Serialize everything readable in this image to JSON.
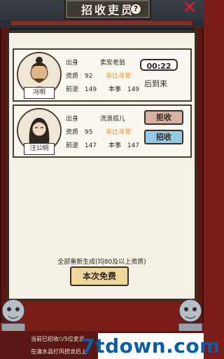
{
  "header": {
    "title": "招收吏员"
  },
  "candidates": [
    {
      "name": "冯明",
      "origin_label": "出身",
      "origin": "卖炭老翁",
      "aptitude_label": "资质",
      "aptitude": "92",
      "rank": "非比寻常",
      "prospect_label": "前途",
      "prospect": "149",
      "skill_label": "本事",
      "skill": "149",
      "timer": "00:22",
      "later_label": "后到来"
    },
    {
      "name": "汪公明",
      "origin_label": "出身",
      "origin": "流浪孤儿",
      "aptitude_label": "资质",
      "aptitude": "95",
      "rank": "非比寻常",
      "prospect_label": "前途",
      "prospect": "147",
      "skill_label": "本事",
      "skill": "147",
      "reject_label": "拒收",
      "recruit_label": "招收"
    }
  ],
  "footer_controls": {
    "regen_text": "全部重新生成(均80及以上资质)",
    "free_button": "本次免费"
  },
  "status": {
    "line1_prefix": "当前已招收",
    "line1_count": "0",
    "line1_suffix": "/5位吏员",
    "line2": "在清水县打风捞龙后上"
  },
  "watermark": "7tdown.com",
  "colors": {
    "orange": "#f08a19",
    "recruit_blue": "#93cbe6",
    "reject_pink": "#d9b0a1",
    "frame_red": "#7a1d19"
  }
}
